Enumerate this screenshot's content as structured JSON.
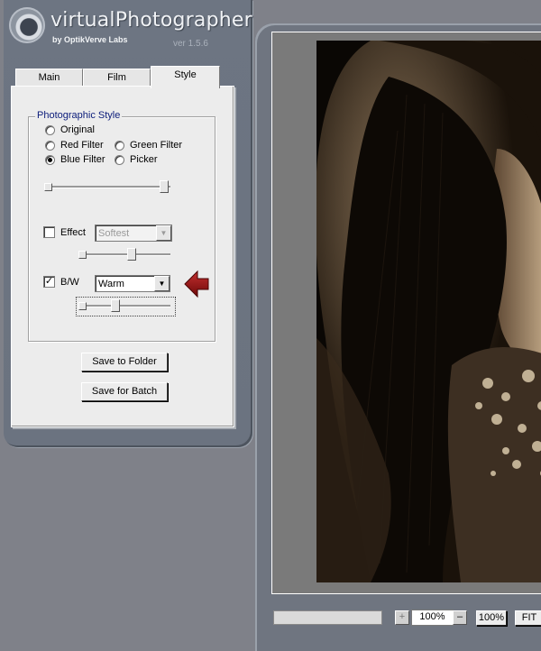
{
  "app": {
    "title": "virtualPhotographer",
    "byline": "by OptikVerve Labs",
    "version": "ver 1.5.6"
  },
  "tabs": [
    {
      "label": "Main",
      "active": false
    },
    {
      "label": "Film",
      "active": false
    },
    {
      "label": "Style",
      "active": true
    }
  ],
  "style_panel": {
    "group_label": "Photographic Style",
    "radios": [
      {
        "label": "Original",
        "selected": false
      },
      {
        "label": "Red Filter",
        "selected": false
      },
      {
        "label": "Green Filter",
        "selected": false
      },
      {
        "label": "Blue Filter",
        "selected": true
      },
      {
        "label": "Picker",
        "selected": false
      }
    ],
    "effect": {
      "label": "Effect",
      "checked": false,
      "value": "Softest",
      "enabled": false
    },
    "bw": {
      "label": "B/W",
      "checked": true,
      "value": "Warm",
      "enabled": true
    },
    "save_to_folder": "Save to Folder",
    "save_for_batch": "Save for Batch"
  },
  "preview": {
    "zoom_value": "100%",
    "zoom_in_symbol": "+",
    "zoom_out_symbol": "–",
    "btn_100": "100%",
    "btn_fit": "FIT"
  },
  "colors": {
    "annotation_arrow": "#8b0a0a",
    "legend_text": "#0b1c7a"
  }
}
